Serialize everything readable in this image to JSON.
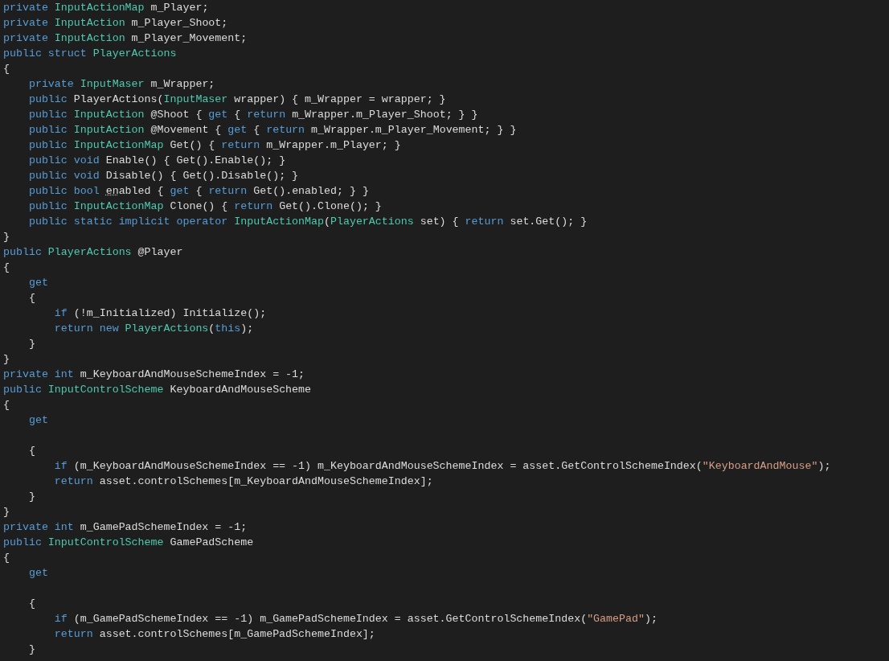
{
  "editor": {
    "lines": [
      {
        "kind": "code",
        "tokens": [
          {
            "kind": "keyword",
            "text": "private "
          },
          {
            "kind": "type",
            "text": "InputActionMap"
          },
          {
            "kind": "plain",
            "text": " m_Player;"
          }
        ]
      },
      {
        "kind": "code",
        "tokens": [
          {
            "kind": "keyword",
            "text": "private "
          },
          {
            "kind": "type",
            "text": "InputAction"
          },
          {
            "kind": "plain",
            "text": " m_Player_Shoot;"
          }
        ]
      },
      {
        "kind": "code",
        "tokens": [
          {
            "kind": "keyword",
            "text": "private "
          },
          {
            "kind": "type",
            "text": "InputAction"
          },
          {
            "kind": "plain",
            "text": " m_Player_Movement;"
          }
        ]
      },
      {
        "kind": "code",
        "tokens": [
          {
            "kind": "keyword",
            "text": "public struct "
          },
          {
            "kind": "type",
            "text": "PlayerActions"
          }
        ]
      },
      {
        "kind": "code",
        "tokens": [
          {
            "kind": "plain",
            "text": "{"
          }
        ]
      },
      {
        "kind": "code",
        "tokens": [
          {
            "kind": "keyword",
            "text": "    private "
          },
          {
            "kind": "type",
            "text": "InputMaser"
          },
          {
            "kind": "plain",
            "text": " m_Wrapper;"
          }
        ]
      },
      {
        "kind": "code",
        "tokens": [
          {
            "kind": "keyword",
            "text": "    public "
          },
          {
            "kind": "plain",
            "text": "PlayerActions("
          },
          {
            "kind": "type",
            "text": "InputMaser"
          },
          {
            "kind": "plain",
            "text": " wrapper) { m_Wrapper = wrapper; }"
          }
        ]
      },
      {
        "kind": "code",
        "tokens": [
          {
            "kind": "keyword",
            "text": "    public "
          },
          {
            "kind": "type",
            "text": "InputAction"
          },
          {
            "kind": "plain",
            "text": " @Shoot { "
          },
          {
            "kind": "keyword",
            "text": "get"
          },
          {
            "kind": "plain",
            "text": " { "
          },
          {
            "kind": "keyword",
            "text": "return"
          },
          {
            "kind": "plain",
            "text": " m_Wrapper.m_Player_Shoot; } }"
          }
        ]
      },
      {
        "kind": "code",
        "tokens": [
          {
            "kind": "keyword",
            "text": "    public "
          },
          {
            "kind": "type",
            "text": "InputAction"
          },
          {
            "kind": "plain",
            "text": " @Movement { "
          },
          {
            "kind": "keyword",
            "text": "get"
          },
          {
            "kind": "plain",
            "text": " { "
          },
          {
            "kind": "keyword",
            "text": "return"
          },
          {
            "kind": "plain",
            "text": " m_Wrapper.m_Player_Movement; } }"
          }
        ]
      },
      {
        "kind": "code",
        "tokens": [
          {
            "kind": "keyword",
            "text": "    public "
          },
          {
            "kind": "type",
            "text": "InputActionMap"
          },
          {
            "kind": "plain",
            "text": " Get() { "
          },
          {
            "kind": "keyword",
            "text": "return"
          },
          {
            "kind": "plain",
            "text": " m_Wrapper.m_Player; }"
          }
        ]
      },
      {
        "kind": "code",
        "tokens": [
          {
            "kind": "keyword",
            "text": "    public void"
          },
          {
            "kind": "plain",
            "text": " Enable() { Get().Enable(); }"
          }
        ]
      },
      {
        "kind": "code",
        "tokens": [
          {
            "kind": "keyword",
            "text": "    public void"
          },
          {
            "kind": "plain",
            "text": " Disable() { Get().Disable(); }"
          }
        ]
      },
      {
        "kind": "code",
        "tokens": [
          {
            "kind": "keyword",
            "text": "    public bool "
          },
          {
            "kind": "hint",
            "text": "en"
          },
          {
            "kind": "plain",
            "text": "abled { "
          },
          {
            "kind": "keyword",
            "text": "get"
          },
          {
            "kind": "plain",
            "text": " { "
          },
          {
            "kind": "keyword",
            "text": "return"
          },
          {
            "kind": "plain",
            "text": " Get().enabled; } }"
          }
        ]
      },
      {
        "kind": "code",
        "tokens": [
          {
            "kind": "keyword",
            "text": "    public "
          },
          {
            "kind": "type",
            "text": "InputActionMap"
          },
          {
            "kind": "plain",
            "text": " Clone() { "
          },
          {
            "kind": "keyword",
            "text": "return"
          },
          {
            "kind": "plain",
            "text": " Get().Clone(); }"
          }
        ]
      },
      {
        "kind": "code",
        "tokens": [
          {
            "kind": "keyword",
            "text": "    public static implicit operator "
          },
          {
            "kind": "type",
            "text": "InputActionMap"
          },
          {
            "kind": "plain",
            "text": "("
          },
          {
            "kind": "type",
            "text": "PlayerActions"
          },
          {
            "kind": "plain",
            "text": " set) { "
          },
          {
            "kind": "keyword",
            "text": "return"
          },
          {
            "kind": "plain",
            "text": " set.Get(); }"
          }
        ]
      },
      {
        "kind": "code",
        "tokens": [
          {
            "kind": "plain",
            "text": "}"
          }
        ]
      },
      {
        "kind": "code",
        "tokens": [
          {
            "kind": "keyword",
            "text": "public "
          },
          {
            "kind": "type",
            "text": "PlayerActions"
          },
          {
            "kind": "plain",
            "text": " @Player"
          }
        ]
      },
      {
        "kind": "code",
        "tokens": [
          {
            "kind": "plain",
            "text": "{"
          }
        ]
      },
      {
        "kind": "code",
        "tokens": [
          {
            "kind": "keyword",
            "text": "    get"
          }
        ]
      },
      {
        "kind": "code",
        "tokens": [
          {
            "kind": "plain",
            "text": "    {"
          }
        ]
      },
      {
        "kind": "code",
        "tokens": [
          {
            "kind": "keyword",
            "text": "        if"
          },
          {
            "kind": "plain",
            "text": " (!m_Initialized) Initialize();"
          }
        ]
      },
      {
        "kind": "code",
        "tokens": [
          {
            "kind": "keyword",
            "text": "        return new "
          },
          {
            "kind": "type",
            "text": "PlayerActions"
          },
          {
            "kind": "plain",
            "text": "("
          },
          {
            "kind": "keyword",
            "text": "this"
          },
          {
            "kind": "plain",
            "text": ");"
          }
        ]
      },
      {
        "kind": "code",
        "tokens": [
          {
            "kind": "plain",
            "text": "    }"
          }
        ]
      },
      {
        "kind": "code",
        "tokens": [
          {
            "kind": "plain",
            "text": "}"
          }
        ]
      },
      {
        "kind": "code",
        "tokens": [
          {
            "kind": "keyword",
            "text": "private int"
          },
          {
            "kind": "plain",
            "text": " m_KeyboardAndMouseSchemeIndex = -1;"
          }
        ]
      },
      {
        "kind": "code",
        "tokens": [
          {
            "kind": "keyword",
            "text": "public "
          },
          {
            "kind": "type",
            "text": "InputControlScheme"
          },
          {
            "kind": "plain",
            "text": " KeyboardAndMouseScheme"
          }
        ]
      },
      {
        "kind": "code",
        "tokens": [
          {
            "kind": "plain",
            "text": "{"
          }
        ]
      },
      {
        "kind": "code",
        "tokens": [
          {
            "kind": "keyword",
            "text": "    get"
          }
        ]
      },
      {
        "kind": "blank"
      },
      {
        "kind": "code",
        "tokens": [
          {
            "kind": "plain",
            "text": "    {"
          }
        ]
      },
      {
        "kind": "code",
        "tokens": [
          {
            "kind": "keyword",
            "text": "        if"
          },
          {
            "kind": "plain",
            "text": " (m_KeyboardAndMouseSchemeIndex == -1) m_KeyboardAndMouseSchemeIndex = asset.GetControlSchemeIndex("
          },
          {
            "kind": "string",
            "text": "\"KeyboardAndMouse\""
          },
          {
            "kind": "plain",
            "text": ");"
          }
        ]
      },
      {
        "kind": "code",
        "tokens": [
          {
            "kind": "keyword",
            "text": "        return"
          },
          {
            "kind": "plain",
            "text": " asset.controlSchemes[m_KeyboardAndMouseSchemeIndex];"
          }
        ]
      },
      {
        "kind": "code",
        "tokens": [
          {
            "kind": "plain",
            "text": "    }"
          }
        ]
      },
      {
        "kind": "code",
        "tokens": [
          {
            "kind": "plain",
            "text": "}"
          }
        ]
      },
      {
        "kind": "code",
        "tokens": [
          {
            "kind": "keyword",
            "text": "private int"
          },
          {
            "kind": "plain",
            "text": " m_GamePadSchemeIndex = -1;"
          }
        ]
      },
      {
        "kind": "code",
        "tokens": [
          {
            "kind": "keyword",
            "text": "public "
          },
          {
            "kind": "type",
            "text": "InputControlScheme"
          },
          {
            "kind": "plain",
            "text": " GamePadScheme"
          }
        ]
      },
      {
        "kind": "code",
        "tokens": [
          {
            "kind": "plain",
            "text": "{"
          }
        ]
      },
      {
        "kind": "code",
        "tokens": [
          {
            "kind": "keyword",
            "text": "    get"
          }
        ]
      },
      {
        "kind": "blank"
      },
      {
        "kind": "code",
        "tokens": [
          {
            "kind": "plain",
            "text": "    {"
          }
        ]
      },
      {
        "kind": "code",
        "tokens": [
          {
            "kind": "keyword",
            "text": "        if"
          },
          {
            "kind": "plain",
            "text": " (m_GamePadSchemeIndex == -1) m_GamePadSchemeIndex = asset.GetControlSchemeIndex("
          },
          {
            "kind": "string",
            "text": "\"GamePad\""
          },
          {
            "kind": "plain",
            "text": ");"
          }
        ]
      },
      {
        "kind": "code",
        "tokens": [
          {
            "kind": "keyword",
            "text": "        return"
          },
          {
            "kind": "plain",
            "text": " asset.controlSchemes[m_GamePadSchemeIndex];"
          }
        ]
      },
      {
        "kind": "code",
        "tokens": [
          {
            "kind": "plain",
            "text": "    }"
          }
        ]
      }
    ]
  }
}
